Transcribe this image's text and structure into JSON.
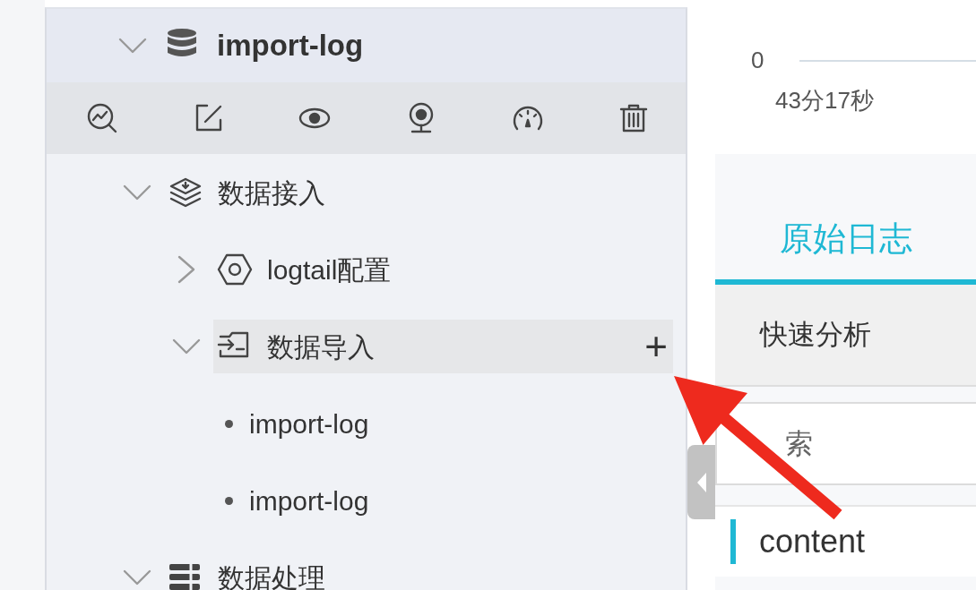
{
  "project": {
    "name": "import-log",
    "expanded": true
  },
  "tree": [
    {
      "kind": "layers",
      "label": "数据接入",
      "expanded": true,
      "selected": false,
      "children": [
        {
          "kind": "hexagon",
          "label": "logtail配置",
          "expanded": false,
          "selected": false
        },
        {
          "kind": "import",
          "label": "数据导入",
          "expanded": true,
          "selected": true,
          "action": "+",
          "children": [
            {
              "kind": "leaf",
              "label": "import-log",
              "selected": false
            },
            {
              "kind": "leaf",
              "label": "import-log",
              "selected": false
            }
          ]
        }
      ]
    },
    {
      "kind": "list",
      "label": "数据处理",
      "expanded": true,
      "selected": false
    }
  ],
  "chart": {
    "tick": "0",
    "time": "43分17秒"
  },
  "tabs": [
    {
      "label": "原始日志",
      "selected": true
    }
  ],
  "quick_analysis": {
    "title": "快速分析"
  },
  "search": {
    "placeholder": "索"
  },
  "fields": [
    {
      "label": "content",
      "selected": true
    }
  ]
}
